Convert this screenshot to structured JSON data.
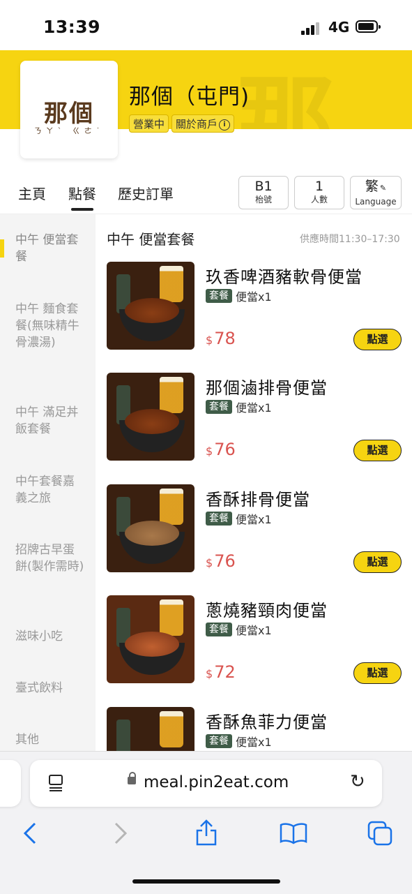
{
  "status_bar": {
    "time": "13:39",
    "network": "4G"
  },
  "store": {
    "logo_text": "那個",
    "logo_sub": "ㄋㄚˋ ㄍㄜ˙",
    "name": "那個（屯門)",
    "status_tag": "營業中",
    "about_tag": "關於商戶",
    "info_icon": "info-icon",
    "brand_color": "#F6D411"
  },
  "tabs": [
    {
      "label": "主頁",
      "active": false
    },
    {
      "label": "點餐",
      "active": true
    },
    {
      "label": "歷史訂單",
      "active": false
    }
  ],
  "table_info": {
    "table_value": "B1",
    "table_label": "枱號",
    "people_value": "1",
    "people_label": "人數",
    "language_value": "繁",
    "language_label": "Language"
  },
  "sidebar": [
    {
      "label": "中午 便當套餐",
      "active": true
    },
    {
      "label": "中午 麵食套餐(無味精牛骨濃湯)"
    },
    {
      "label": "中午 滿足丼飯套餐"
    },
    {
      "label": "中午套餐嘉義之旅"
    },
    {
      "label": "招牌古早蛋餅(製作需時)"
    },
    {
      "label": "滋味小吃"
    },
    {
      "label": "臺式飲料"
    },
    {
      "label": "其他"
    }
  ],
  "section": {
    "title": "中午 便當套餐",
    "serve_time": "供應時間11:30–17:30"
  },
  "items": [
    {
      "name": "玖香啤酒豬軟骨便當",
      "badge": "套餐",
      "desc": "便當x1",
      "currency": "$",
      "price": "78",
      "button": "點選"
    },
    {
      "name": "那個滷排骨便當",
      "badge": "套餐",
      "desc": "便當x1",
      "currency": "$",
      "price": "76",
      "button": "點選"
    },
    {
      "name": "香酥排骨便當",
      "badge": "套餐",
      "desc": "便當x1",
      "currency": "$",
      "price": "76",
      "button": "點選"
    },
    {
      "name": "蔥燒豬頸肉便當",
      "badge": "套餐",
      "desc": "便當x1",
      "currency": "$",
      "price": "72",
      "button": "點選"
    },
    {
      "name": "香酥魚菲力便當",
      "badge": "套餐",
      "desc": "便當x1"
    }
  ],
  "browser": {
    "url": "meal.pin2eat.com",
    "icons": [
      "page-menu-icon",
      "lock-icon",
      "reload-icon",
      "back-icon",
      "forward-icon",
      "share-icon",
      "bookmarks-icon",
      "tabs-icon"
    ]
  }
}
